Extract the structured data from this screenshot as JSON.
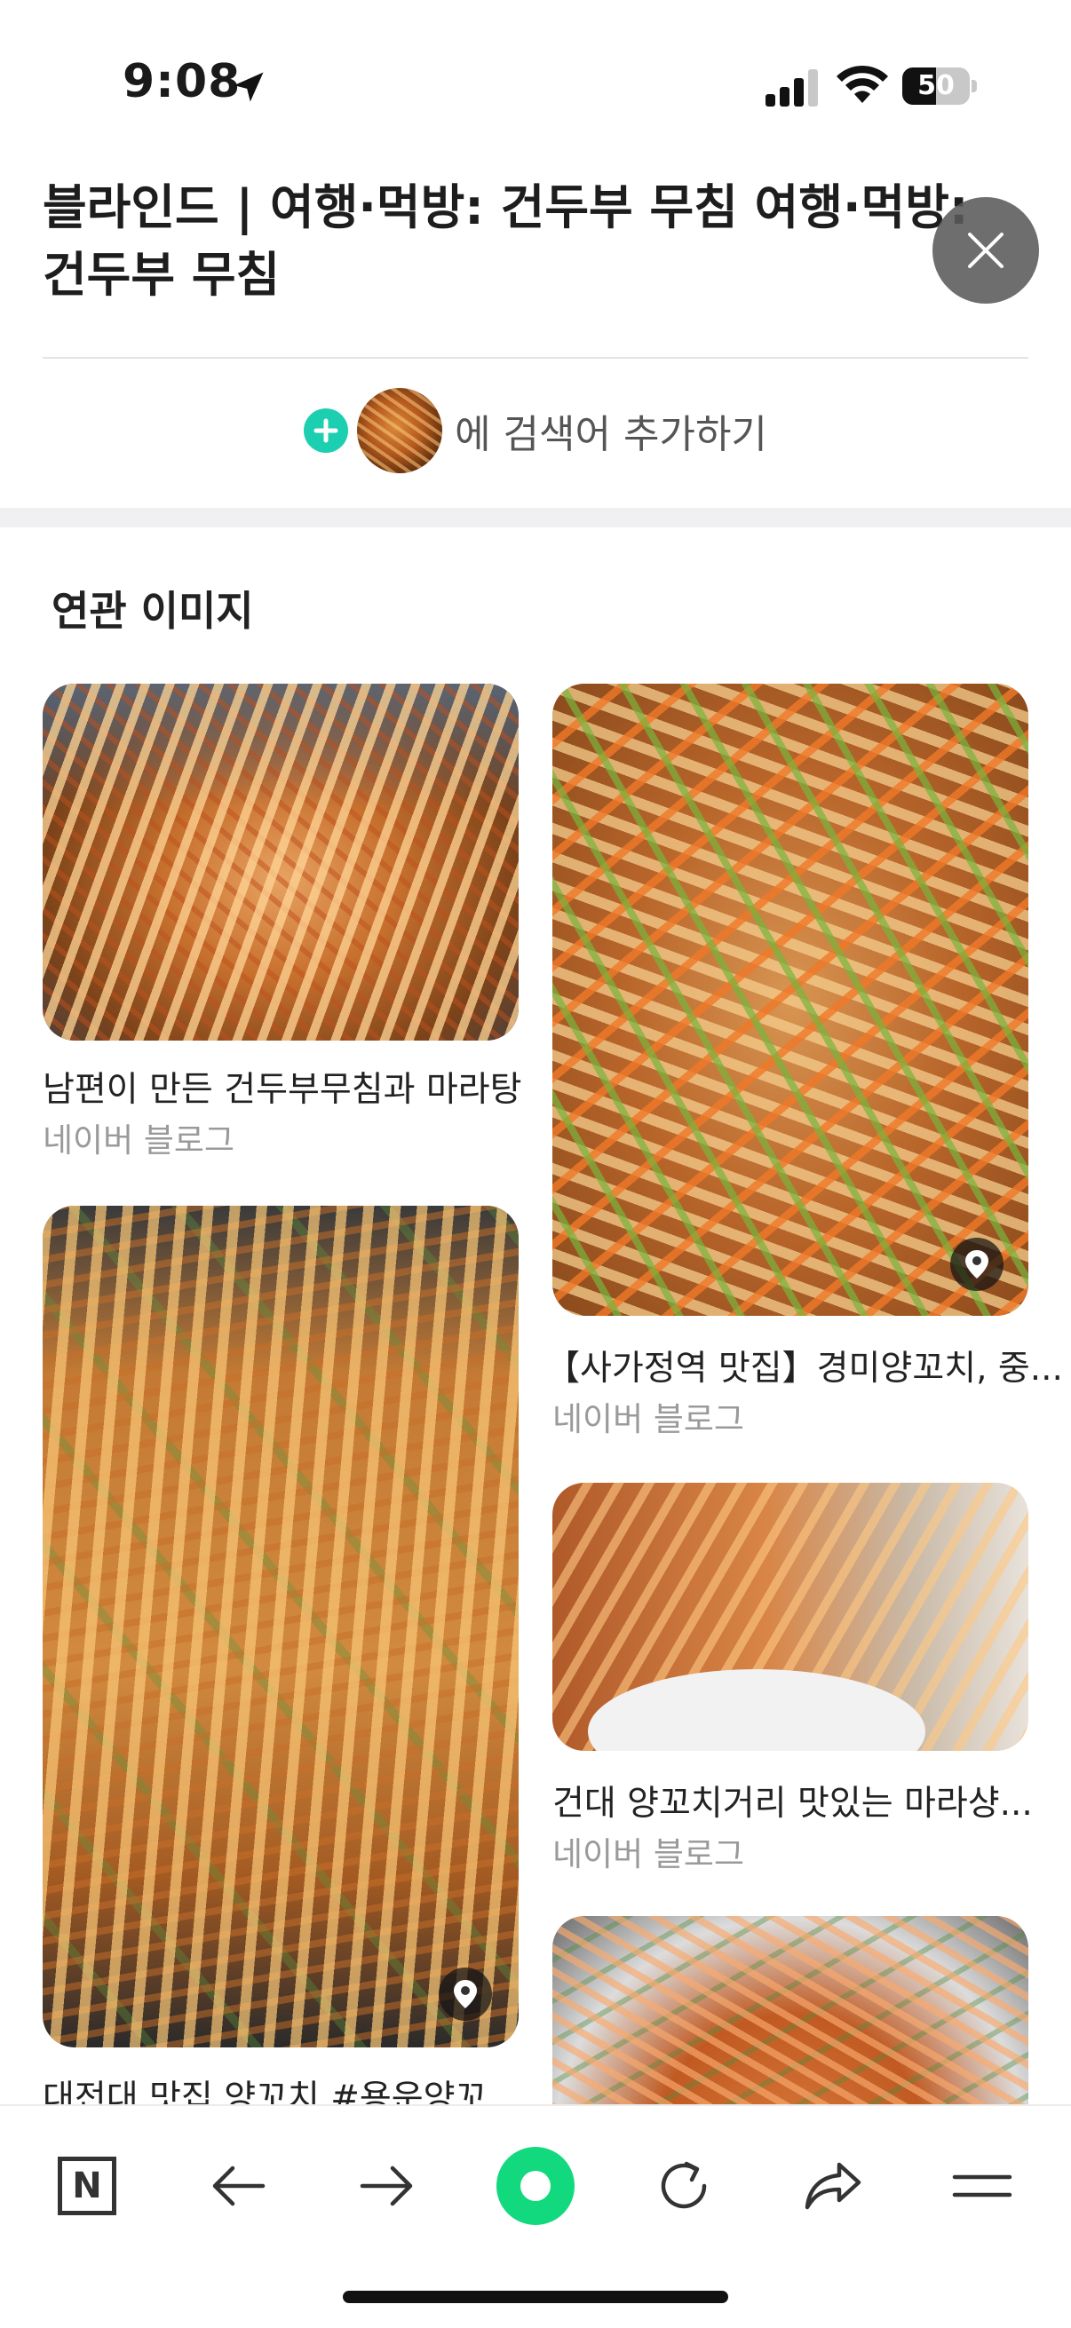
{
  "status_bar": {
    "time": "9:08",
    "battery_level": "50"
  },
  "header": {
    "title": "블라인드 | 여행·먹방: 건두부 무침 여행·먹방: 건두부 무침"
  },
  "add_search": {
    "label": "에 검색어 추가하기"
  },
  "related": {
    "section_title": "연관 이미지",
    "items": [
      {
        "caption": "남편이 만든 건두부무침과 마라탕",
        "source": "네이버 블로그"
      },
      {
        "caption": "【사가정역 맛집】경미양꼬치, 중...",
        "source": "네이버 블로그",
        "has_location": true
      },
      {
        "caption": "대전대 맛집 양꼬치 #용운양꼬...",
        "source": "",
        "has_location": true
      },
      {
        "caption": "건대 양꼬치거리 맛있는 마라샹...",
        "source": "네이버 블로그"
      },
      {
        "caption": "",
        "source": ""
      }
    ]
  },
  "toolbar": {
    "logo_letter": "N",
    "icons": [
      "naver-home-icon",
      "back-arrow-icon",
      "forward-arrow-icon",
      "green-dot-icon",
      "refresh-icon",
      "share-icon",
      "menu-icon"
    ]
  },
  "colors": {
    "accent_green": "#12d87e",
    "add_plus": "#1ccfb0"
  }
}
